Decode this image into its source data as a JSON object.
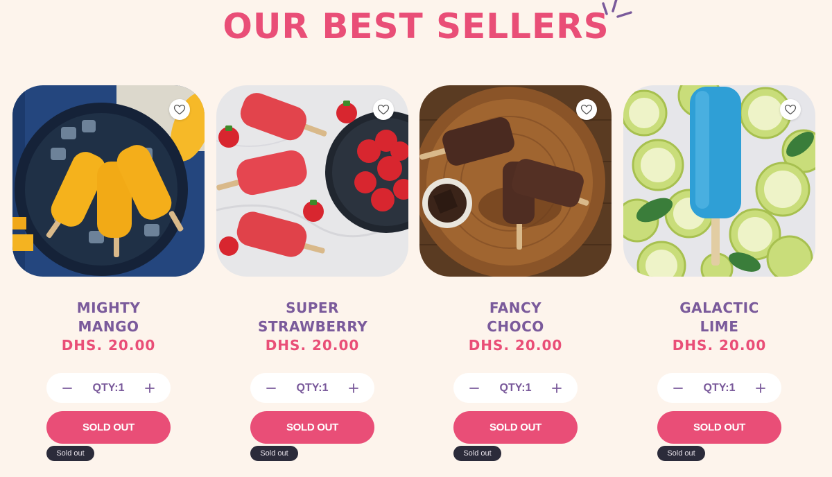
{
  "section": {
    "title": "OUR BEST SELLERS"
  },
  "colors": {
    "background": "#fdf4ec",
    "title": "#e94e77",
    "name": "#7a5a9b",
    "price": "#e94e77",
    "button": "#e94e77",
    "badge": "#2b2b3a"
  },
  "products": [
    {
      "name": "MIGHTY MANGO",
      "price": "DHS. 20.00",
      "qty_label": "QTY:1",
      "button_label": "SOLD OUT",
      "badge": "Sold out",
      "image": "mango-popsicles-on-ice"
    },
    {
      "name": "SUPER STRAWBERRY",
      "price": "DHS. 20.00",
      "qty_label": "QTY:1",
      "button_label": "SOLD OUT",
      "badge": "Sold out",
      "image": "strawberry-popsicles-with-berries"
    },
    {
      "name": "FANCY CHOCO",
      "price": "DHS. 20.00",
      "qty_label": "QTY:1",
      "button_label": "SOLD OUT",
      "badge": "Sold out",
      "image": "chocolate-popsicles-on-wood"
    },
    {
      "name": "GALACTIC LIME",
      "price": "DHS. 20.00",
      "qty_label": "QTY:1",
      "button_label": "SOLD OUT",
      "badge": "Sold out",
      "image": "blue-popsicle-on-lime-slices"
    }
  ]
}
